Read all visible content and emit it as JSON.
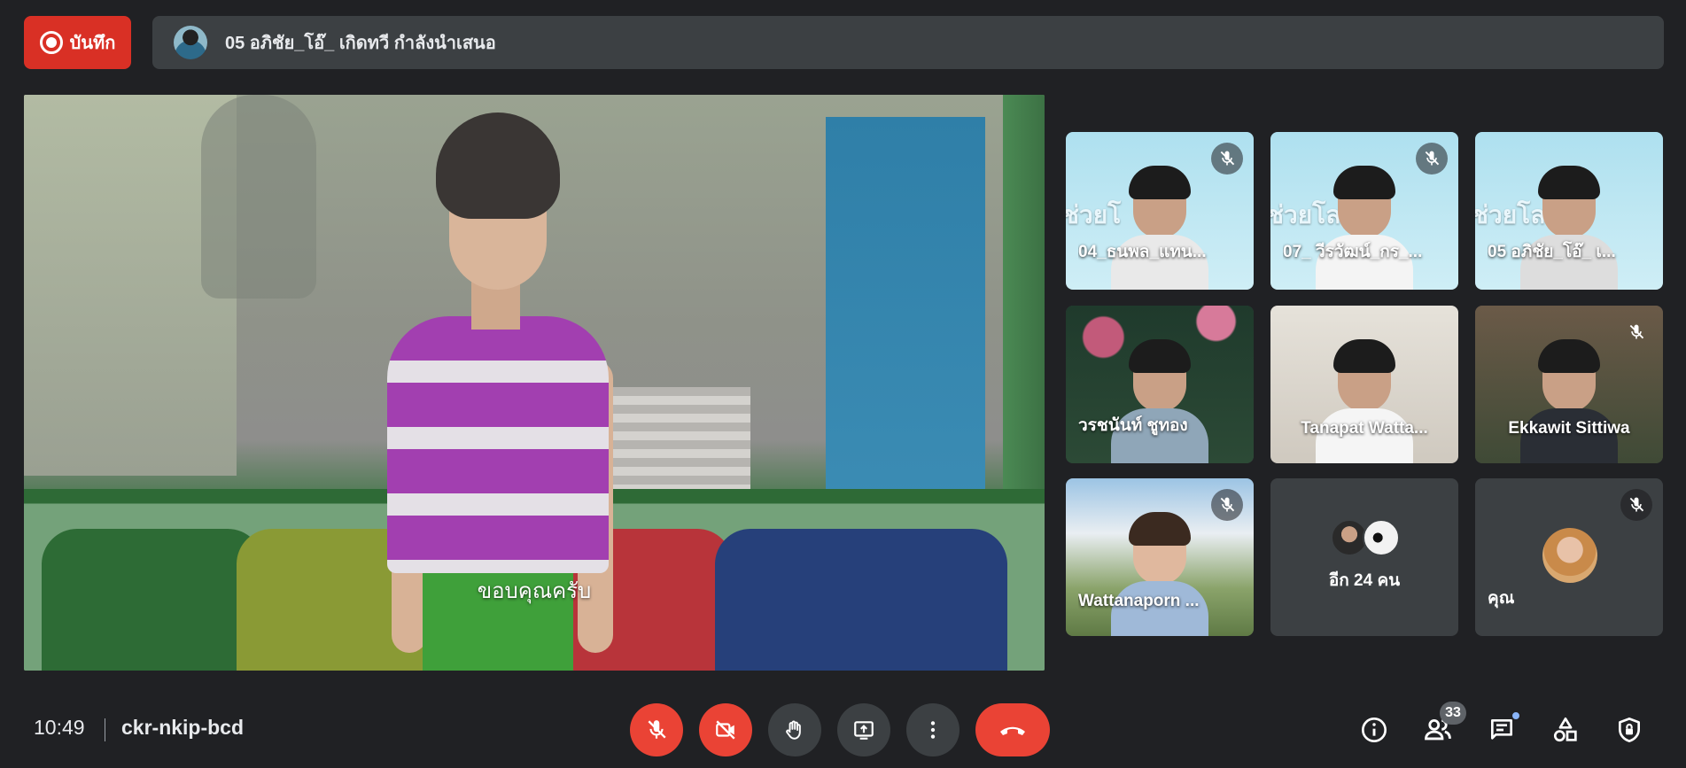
{
  "top": {
    "record_label": "บันทึก",
    "presenter_text": "05 อภิชัย_โอ๊_ เกิดทวี กำลังนำเสนอ"
  },
  "stage": {
    "caption": "ขอบคุณครับ"
  },
  "tiles": [
    {
      "name": "04_ธนพล_แทน...",
      "muted": true,
      "overlay": "ช่วยโ"
    },
    {
      "name": "07_ วีรวัฒน์_กร_...",
      "muted": true,
      "overlay": "ช่วยโลก"
    },
    {
      "name": "05 อภิชัย_โอ๊_ เ...",
      "muted": false,
      "overlay": "ช่วยโล"
    },
    {
      "name": "วรชนันท์ ชูทอง",
      "muted": false
    },
    {
      "name": "Tanapat Watta...",
      "muted": false
    },
    {
      "name": "Ekkawit Sittiwa",
      "muted": true
    },
    {
      "name": "Wattanaporn ...",
      "muted": true
    },
    {
      "name": "อีก 24 คน",
      "muted": false
    },
    {
      "name": "คุณ",
      "muted": true
    }
  ],
  "bottom": {
    "time": "10:49",
    "meeting_code": "ckr-nkip-bcd",
    "participants_count": "33"
  },
  "colors": {
    "accent_red": "#ea4335",
    "record_red": "#d93025",
    "background": "#202124",
    "surface": "#3c4043"
  },
  "icons": [
    "record-icon",
    "mic-off-icon",
    "camera-off-icon",
    "raise-hand-icon",
    "present-icon",
    "more-options-icon",
    "end-call-icon",
    "info-icon",
    "people-icon",
    "chat-icon",
    "activities-icon",
    "host-controls-icon"
  ]
}
